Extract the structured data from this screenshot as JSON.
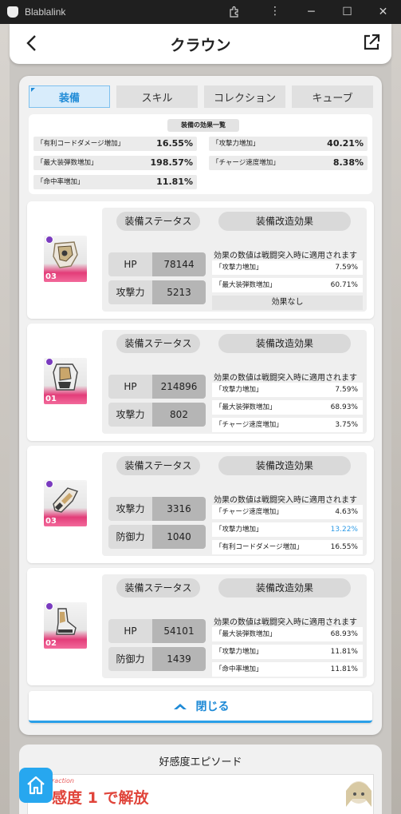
{
  "window": {
    "app_title": "Blablalink"
  },
  "header": {
    "title": "クラウン"
  },
  "tabs": [
    {
      "label": "装備",
      "active": true
    },
    {
      "label": "スキル",
      "active": false
    },
    {
      "label": "コレクション",
      "active": false
    },
    {
      "label": "キューブ",
      "active": false
    }
  ],
  "summary": {
    "title": "装備の効果一覧",
    "effects": [
      {
        "name": "「有利コードダメージ増加」",
        "value": "16.55%"
      },
      {
        "name": "「攻撃力増加」",
        "value": "40.21%"
      },
      {
        "name": "「最大装弾数増加」",
        "value": "198.57%"
      },
      {
        "name": "「チャージ速度増加」",
        "value": "8.38%"
      },
      {
        "name": "「命中率増加」",
        "value": "11.81%"
      }
    ]
  },
  "labels": {
    "status": "装備ステータス",
    "modification": "装備改造効果",
    "note": "効果の数値は戦闘突入時に適用されます"
  },
  "equipment": [
    {
      "level": "03",
      "stats": [
        {
          "label": "HP",
          "value": "78144"
        },
        {
          "label": "攻撃力",
          "value": "5213"
        }
      ],
      "mods": [
        {
          "name": "「攻撃力増加」",
          "value": "7.59%",
          "highlight": false
        },
        {
          "name": "「最大装弾数増加」",
          "value": "60.71%",
          "highlight": false
        }
      ],
      "none_text": "効果なし"
    },
    {
      "level": "01",
      "stats": [
        {
          "label": "HP",
          "value": "214896"
        },
        {
          "label": "攻撃力",
          "value": "802"
        }
      ],
      "mods": [
        {
          "name": "「攻撃力増加」",
          "value": "7.59%",
          "highlight": false
        },
        {
          "name": "「最大装弾数増加」",
          "value": "68.93%",
          "highlight": false
        },
        {
          "name": "「チャージ速度増加」",
          "value": "3.75%",
          "highlight": false
        }
      ]
    },
    {
      "level": "03",
      "stats": [
        {
          "label": "攻撃力",
          "value": "3316"
        },
        {
          "label": "防御力",
          "value": "1040"
        }
      ],
      "mods": [
        {
          "name": "「チャージ速度増加」",
          "value": "4.63%",
          "highlight": false
        },
        {
          "name": "「攻撃力増加」",
          "value": "13.22%",
          "highlight": true
        },
        {
          "name": "「有利コードダメージ増加」",
          "value": "16.55%",
          "highlight": false
        }
      ]
    },
    {
      "level": "02",
      "stats": [
        {
          "label": "HP",
          "value": "54101"
        },
        {
          "label": "防御力",
          "value": "1439"
        }
      ],
      "mods": [
        {
          "name": "「最大装弾数増加」",
          "value": "68.93%",
          "highlight": false
        },
        {
          "name": "「攻撃力増加」",
          "value": "11.81%",
          "highlight": false
        },
        {
          "name": "「命中率増加」",
          "value": "11.81%",
          "highlight": false
        }
      ]
    }
  ],
  "close_label": "閉じる",
  "episode": {
    "title": "好感度エピソード",
    "tag": "raction",
    "lock_text": "感度 1 で解放"
  },
  "colors": {
    "accent": "#1e8ad6",
    "highlight": "#2e9be6",
    "rarity": "#e33d79"
  }
}
